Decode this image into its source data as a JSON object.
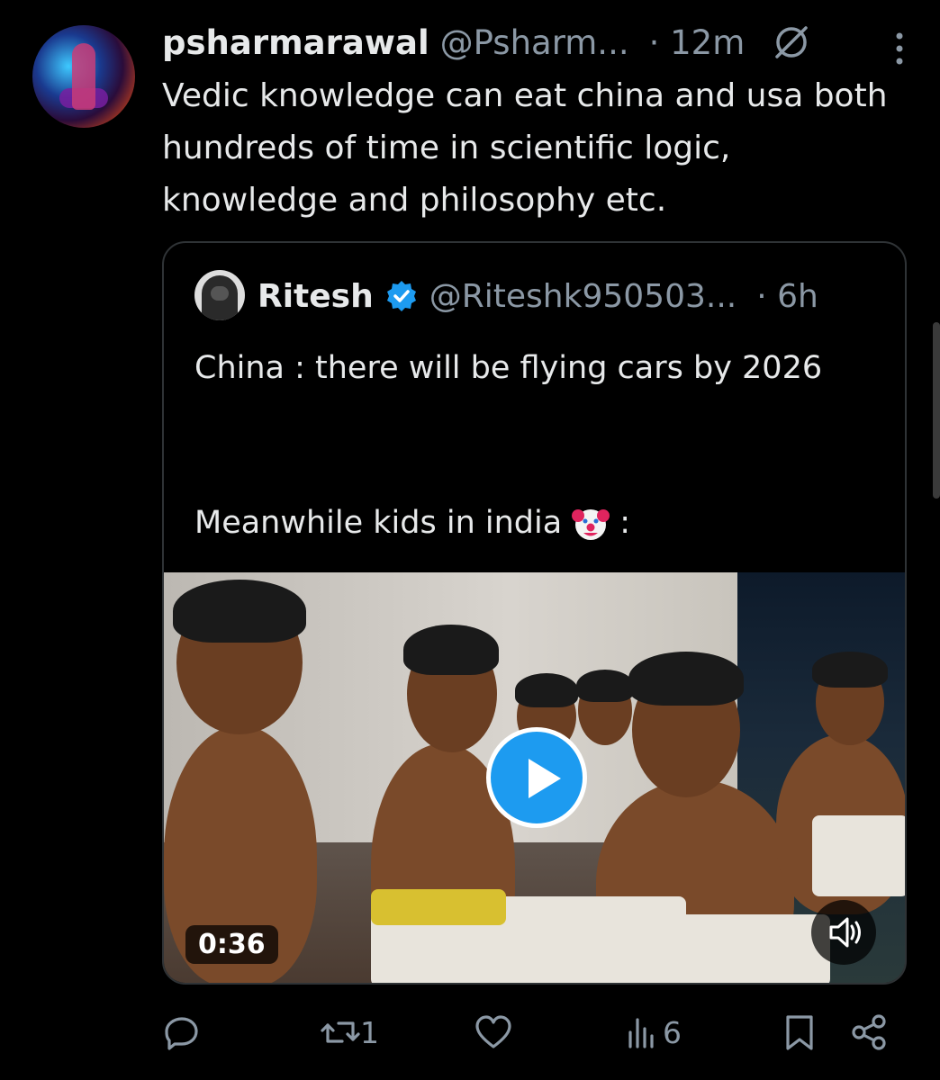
{
  "tweet": {
    "display_name": "psharmarawal",
    "handle": "@Psharm...",
    "time": "· 12m",
    "text": "Vedic knowledge can eat china and usa both hundreds of time in scientific logic, knowledge and philosophy etc."
  },
  "quote": {
    "display_name": "Ritesh",
    "handle": "@Riteshk950503...",
    "time": "· 6h",
    "text_line1": "China : there will be flying cars by 2026",
    "text_line2_before": "Meanwhile kids in india",
    "text_line2_after": ":",
    "video": {
      "duration": "0:36"
    }
  },
  "actions": {
    "reply_count": "",
    "retweet_count": "1",
    "like_count": "",
    "views_count": "6"
  },
  "colors": {
    "background": "#000000",
    "text_primary": "#e7e9ea",
    "text_secondary": "#8b98a5",
    "accent": "#1d9bf0",
    "border": "#2f3336"
  },
  "icons": [
    "grok-icon",
    "more-icon",
    "verified-icon",
    "clown-emoji-icon",
    "play-icon",
    "sound-icon",
    "reply-icon",
    "retweet-icon",
    "like-icon",
    "views-icon",
    "bookmark-icon",
    "share-icon"
  ]
}
